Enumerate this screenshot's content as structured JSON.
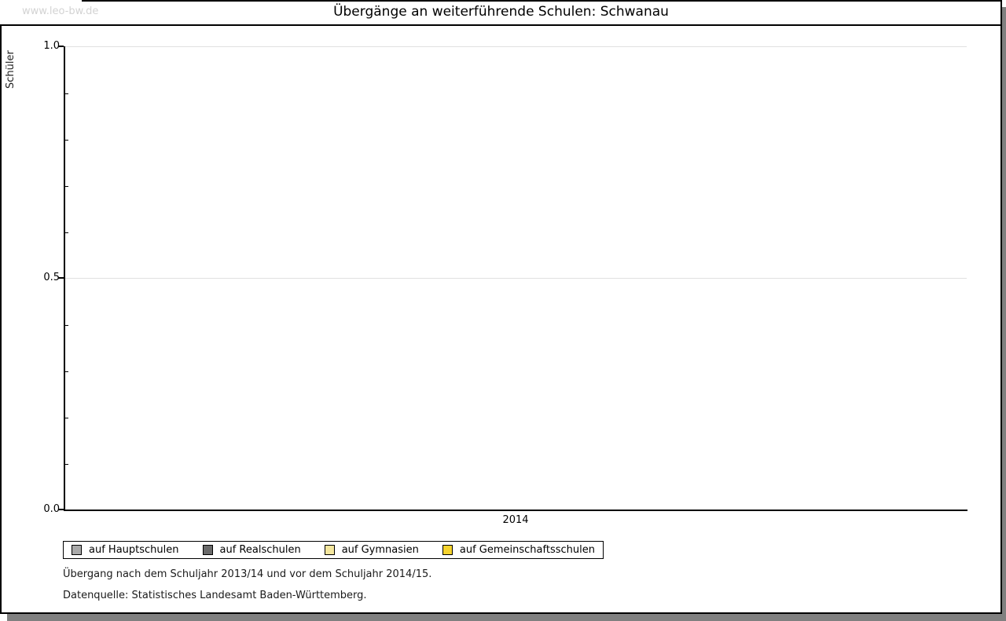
{
  "watermark": "www.leo-bw.de",
  "header": {
    "title": "Übergänge an weiterführende Schulen: Schwanau"
  },
  "chart_data": {
    "type": "bar",
    "title": "Übergänge an weiterführende Schulen: Schwanau",
    "categories": [
      "2014"
    ],
    "series": [
      {
        "name": "auf Hauptschulen",
        "values": [
          null
        ],
        "color": "#a9a9a9"
      },
      {
        "name": "auf Realschulen",
        "values": [
          null
        ],
        "color": "#696969"
      },
      {
        "name": "auf Gymnasien",
        "values": [
          null
        ],
        "color": "#f5e79e"
      },
      {
        "name": "auf Gemeinschaftsschulen",
        "values": [
          null
        ],
        "color": "#f6d32d"
      }
    ],
    "bars_visible": false,
    "xlabel": "",
    "ylabel": "Schüler",
    "ylim": [
      0.0,
      1.0
    ],
    "ytick_labels": {
      "top": "1.0",
      "mid": "0.5",
      "bottom": "0.0"
    },
    "xtick_labels": [
      "2014"
    ],
    "grid": "horizontal gridlines at 0.5 and 1.0",
    "legend_position": "bottom-left"
  },
  "legend": {
    "items": [
      {
        "label": "auf Hauptschulen",
        "color": "#a9a9a9"
      },
      {
        "label": "auf Realschulen",
        "color": "#696969"
      },
      {
        "label": "auf Gymnasien",
        "color": "#f5e79e"
      },
      {
        "label": "auf Gemeinschaftsschulen",
        "color": "#f6d32d"
      }
    ]
  },
  "footer": {
    "line1": "Übergang nach dem Schuljahr 2013/14 und vor dem Schuljahr 2014/15.",
    "line2": "Datenquelle: Statistisches Landesamt Baden-Württemberg."
  },
  "colors": {
    "grid": "#e0e0e0",
    "watermark_text": "#d3d3d3",
    "frame": "#000000",
    "shadow": "#808080"
  }
}
